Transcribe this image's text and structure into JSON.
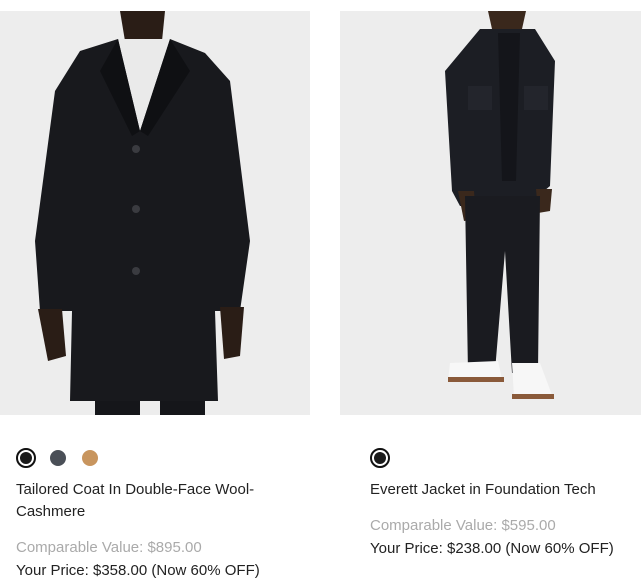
{
  "products": [
    {
      "name": "Tailored Coat In Double-Face Wool-Cashmere",
      "comparable": "Comparable Value: $895.00",
      "price": "Your Price: $358.00 (Now 60% OFF)",
      "swatches": [
        {
          "color": "#1a1a1a",
          "selected": true
        },
        {
          "color": "#4a4f57",
          "selected": false
        },
        {
          "color": "#c8955e",
          "selected": false
        }
      ],
      "image": "model-wearing-black-coat"
    },
    {
      "name": "Everett Jacket in Foundation Tech",
      "comparable": "Comparable Value: $595.00",
      "price": "Your Price: $238.00 (Now 60% OFF)",
      "swatches": [
        {
          "color": "#1a1a1a",
          "selected": true
        }
      ],
      "image": "model-wearing-black-jacket"
    }
  ],
  "colors": {
    "photo_background": "#ededed",
    "muted_text": "#aaaaaa",
    "text": "#222222"
  }
}
